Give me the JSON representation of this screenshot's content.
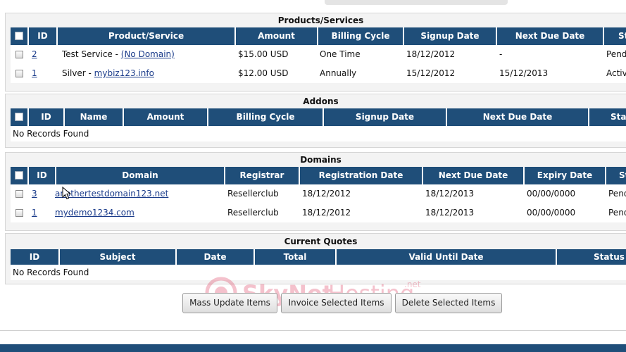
{
  "products": {
    "title": "Products/Services",
    "headers": [
      "ID",
      "Product/Service",
      "Amount",
      "Billing Cycle",
      "Signup Date",
      "Next Due Date",
      "Status"
    ],
    "rows": [
      {
        "id": "2",
        "product": "Test Service - ",
        "product_link": "(No Domain)",
        "amount": "$15.00 USD",
        "cycle": "One Time",
        "signup": "18/12/2012",
        "next_due": "-",
        "status": "Pending"
      },
      {
        "id": "1",
        "product": "Silver - ",
        "product_link": "mybiz123.info",
        "amount": "$12.00 USD",
        "cycle": "Annually",
        "signup": "15/12/2012",
        "next_due": "15/12/2013",
        "status": "Active"
      }
    ]
  },
  "addons": {
    "title": "Addons",
    "headers": [
      "ID",
      "Name",
      "Amount",
      "Billing Cycle",
      "Signup Date",
      "Next Due Date",
      "Status"
    ],
    "empty_text": "No Records Found"
  },
  "domains": {
    "title": "Domains",
    "headers": [
      "ID",
      "Domain",
      "Registrar",
      "Registration Date",
      "Next Due Date",
      "Expiry Date",
      "Status"
    ],
    "rows": [
      {
        "id": "3",
        "domain": "anothertestdomain123.net",
        "registrar": "Resellerclub",
        "reg_date": "18/12/2012",
        "next_due": "18/12/2013",
        "expiry": "00/00/0000",
        "status": "Pending"
      },
      {
        "id": "1",
        "domain": "mydemo1234.com",
        "registrar": "Resellerclub",
        "reg_date": "18/12/2012",
        "next_due": "18/12/2013",
        "expiry": "00/00/0000",
        "status": "Pending"
      }
    ]
  },
  "quotes": {
    "title": "Current Quotes",
    "headers": [
      "ID",
      "Subject",
      "Date",
      "Total",
      "Valid Until Date",
      "Status"
    ],
    "empty_text": "No Records Found"
  },
  "buttons": {
    "mass_update": "Mass Update Items",
    "invoice_selected": "Invoice Selected Items",
    "delete_selected": "Delete Selected Items"
  },
  "watermark": {
    "text_a": "SkyNet",
    "text_b": "Hosting",
    "tld": ".net"
  },
  "colors": {
    "header_bg": "#1f4e79",
    "link": "#1a3b8a",
    "section_bg": "#f3f3f3"
  }
}
